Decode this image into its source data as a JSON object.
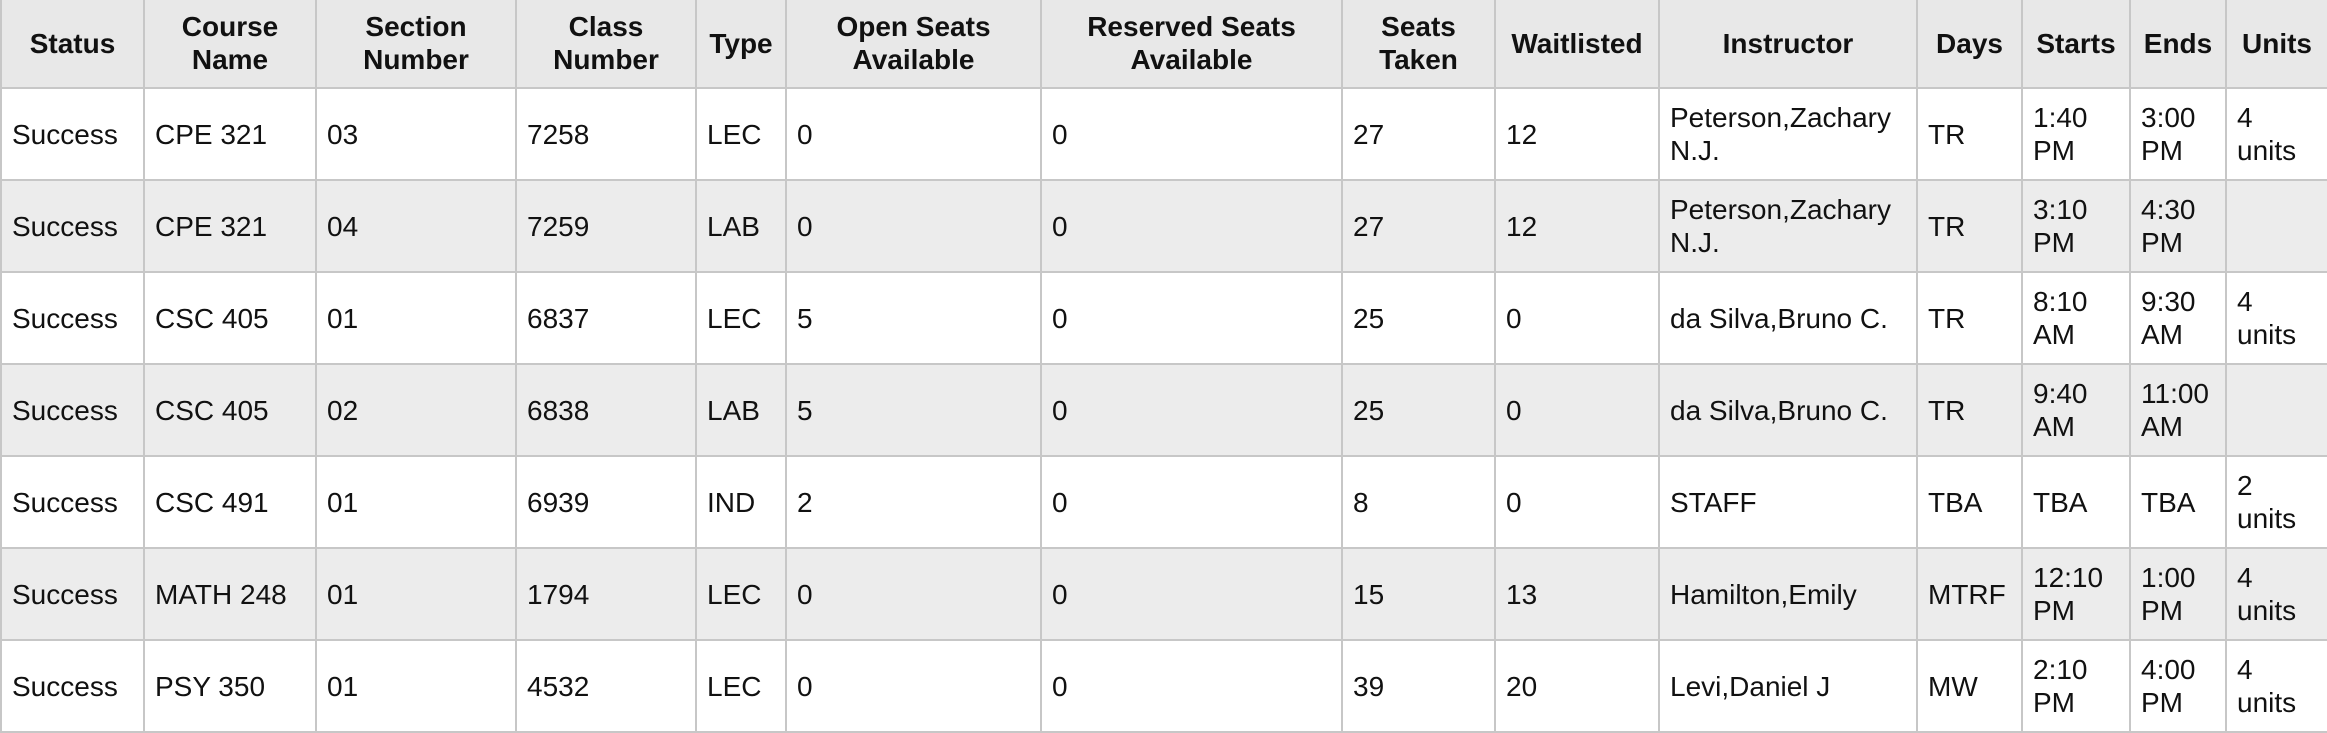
{
  "columns": [
    "Status",
    "Course Name",
    "Section Number",
    "Class Number",
    "Type",
    "Open Seats Available",
    "Reserved Seats Available",
    "Seats Taken",
    "Waitlisted",
    "Instructor",
    "Days",
    "Starts",
    "Ends",
    "Units"
  ],
  "rows": [
    {
      "status": "Success",
      "course": "CPE 321",
      "section": "03",
      "class_number": "7258",
      "type": "LEC",
      "open_seats": "0",
      "reserved_seats": "0",
      "seats_taken": "27",
      "waitlisted": "12",
      "instructor": "Peterson,Zachary N.J.",
      "days": "TR",
      "starts": "1:40 PM",
      "ends": "3:00 PM",
      "units": "4 units"
    },
    {
      "status": "Success",
      "course": "CPE 321",
      "section": "04",
      "class_number": "7259",
      "type": "LAB",
      "open_seats": "0",
      "reserved_seats": "0",
      "seats_taken": "27",
      "waitlisted": "12",
      "instructor": "Peterson,Zachary N.J.",
      "days": "TR",
      "starts": "3:10 PM",
      "ends": "4:30 PM",
      "units": ""
    },
    {
      "status": "Success",
      "course": "CSC 405",
      "section": "01",
      "class_number": "6837",
      "type": "LEC",
      "open_seats": "5",
      "reserved_seats": "0",
      "seats_taken": "25",
      "waitlisted": "0",
      "instructor": "da Silva,Bruno C.",
      "days": "TR",
      "starts": "8:10 AM",
      "ends": "9:30 AM",
      "units": "4 units"
    },
    {
      "status": "Success",
      "course": "CSC 405",
      "section": "02",
      "class_number": "6838",
      "type": "LAB",
      "open_seats": "5",
      "reserved_seats": "0",
      "seats_taken": "25",
      "waitlisted": "0",
      "instructor": "da Silva,Bruno C.",
      "days": "TR",
      "starts": "9:40 AM",
      "ends": "11:00 AM",
      "units": ""
    },
    {
      "status": "Success",
      "course": "CSC 491",
      "section": "01",
      "class_number": "6939",
      "type": "IND",
      "open_seats": "2",
      "reserved_seats": "0",
      "seats_taken": "8",
      "waitlisted": "0",
      "instructor": "STAFF",
      "days": "TBA",
      "starts": "TBA",
      "ends": "TBA",
      "units": "2 units"
    },
    {
      "status": "Success",
      "course": "MATH 248",
      "section": "01",
      "class_number": "1794",
      "type": "LEC",
      "open_seats": "0",
      "reserved_seats": "0",
      "seats_taken": "15",
      "waitlisted": "13",
      "instructor": "Hamilton,Emily",
      "days": "MTRF",
      "starts": "12:10 PM",
      "ends": "1:00 PM",
      "units": "4 units"
    },
    {
      "status": "Success",
      "course": "PSY 350",
      "section": "01",
      "class_number": "4532",
      "type": "LEC",
      "open_seats": "0",
      "reserved_seats": "0",
      "seats_taken": "39",
      "waitlisted": "20",
      "instructor": "Levi,Daniel J",
      "days": "MW",
      "starts": "2:10 PM",
      "ends": "4:00 PM",
      "units": "4 units"
    }
  ]
}
